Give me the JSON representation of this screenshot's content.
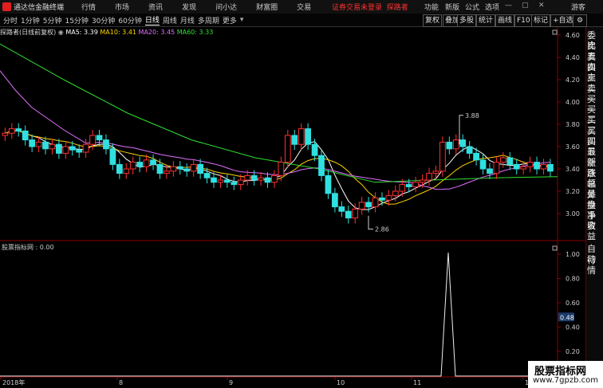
{
  "app": {
    "title": "通达信金融终端",
    "menus": [
      "行情",
      "市场",
      "资讯",
      "发现",
      "问小达",
      "财富圈",
      "交易"
    ],
    "notice": "证券交易未登录",
    "user": "探路者",
    "right_menus": [
      "功能",
      "新版",
      "公式",
      "选项"
    ],
    "guest": "游客"
  },
  "toolbar": {
    "periods": [
      "分时",
      "1分钟",
      "5分钟",
      "15分钟",
      "30分钟",
      "60分钟",
      "日线",
      "周线",
      "月线",
      "多周期",
      "更多"
    ],
    "active": "日线",
    "buttons": [
      "复权",
      "叠加",
      "多股",
      "统计",
      "画线",
      "F10",
      "标记",
      "+自选"
    ]
  },
  "info": {
    "stock": "探路者(日线前复权)",
    "ma5": "MA5: 3.39",
    "ma10": "MA10: 3.41",
    "ma20": "MA20: 3.45",
    "ma60": "MA60: 3.33"
  },
  "price_axis": [
    "4.60",
    "4.40",
    "4.20",
    "4.00",
    "3.80",
    "3.60",
    "3.40",
    "3.20",
    "3.00"
  ],
  "annotations": {
    "high": "3.88",
    "low": "2.86"
  },
  "indicator": {
    "label": "股票指标网 : 0.00",
    "axis": [
      "1.00",
      "0.80",
      "0.60",
      "0.40",
      "0.20"
    ],
    "current": "0.48"
  },
  "dates": [
    "2018年",
    "8",
    "9",
    "10",
    "11",
    "12"
  ],
  "right_panel": [
    "委比",
    "卖五",
    "卖四",
    "卖三",
    "卖二",
    "卖一",
    "买一",
    "买二",
    "买三",
    "买四",
    "买五",
    "最新",
    "涨跌",
    "涨幅",
    "总量",
    "外盘",
    "换手",
    "净资",
    "收益",
    "自动",
    "行情"
  ],
  "watermark": {
    "line1": "股票指标网",
    "line2": "www.7gpzb.com"
  },
  "colors": {
    "up": "#ff3030",
    "down": "#30e0e0",
    "ma5": "#ffffff",
    "ma10": "#ffd400",
    "ma20": "#e070ff",
    "ma60": "#30e030",
    "axis": "#8b0000"
  }
}
